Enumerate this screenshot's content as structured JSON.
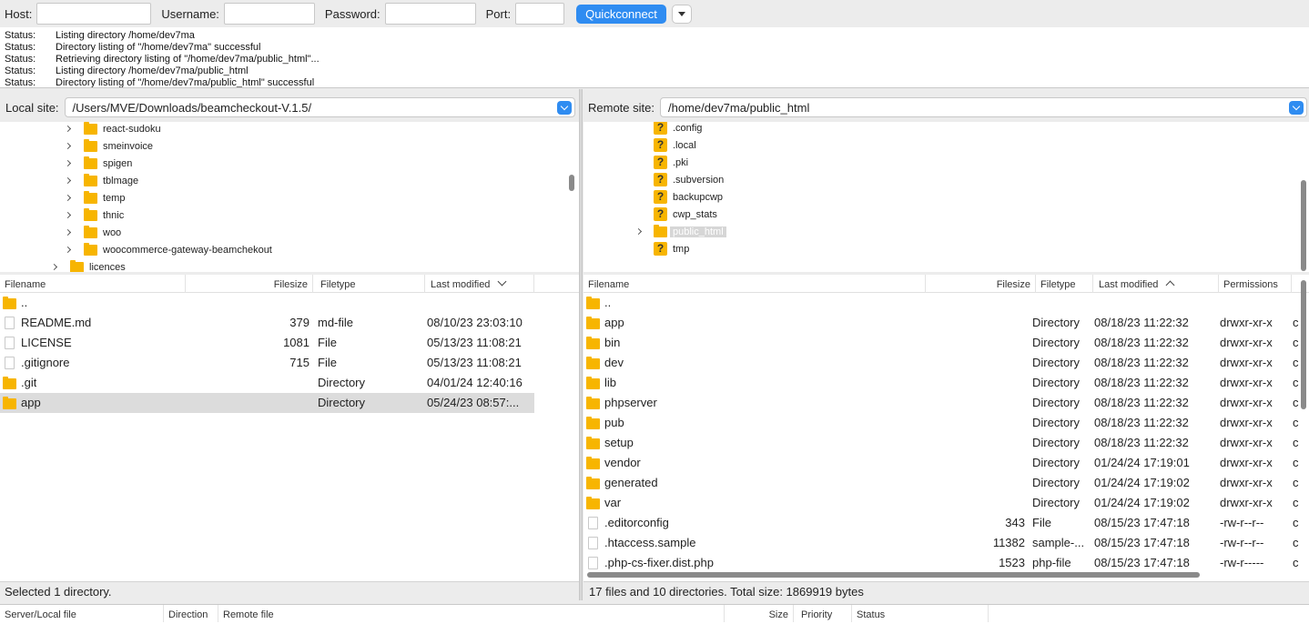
{
  "quickconnect": {
    "host_label": "Host:",
    "username_label": "Username:",
    "password_label": "Password:",
    "port_label": "Port:",
    "button_label": "Quickconnect"
  },
  "log": [
    {
      "label": "Status:",
      "text": "Listing directory /home/dev7ma"
    },
    {
      "label": "Status:",
      "text": "Directory listing of \"/home/dev7ma\" successful"
    },
    {
      "label": "Status:",
      "text": "Retrieving directory listing of \"/home/dev7ma/public_html\"..."
    },
    {
      "label": "Status:",
      "text": "Listing directory /home/dev7ma/public_html"
    },
    {
      "label": "Status:",
      "text": "Directory listing of \"/home/dev7ma/public_html\" successful"
    }
  ],
  "local": {
    "site_label": "Local site:",
    "path": "/Users/MVE/Downloads/beamcheckout-V.1.5/",
    "tree": [
      {
        "name": "react-sudoku"
      },
      {
        "name": "smeinvoice"
      },
      {
        "name": "spigen"
      },
      {
        "name": "tblmage"
      },
      {
        "name": "temp"
      },
      {
        "name": "thnic"
      },
      {
        "name": "woo"
      },
      {
        "name": "woocommerce-gateway-beamchekout"
      },
      {
        "name": "licences"
      }
    ],
    "columns": {
      "filename": "Filename",
      "filesize": "Filesize",
      "filetype": "Filetype",
      "modified": "Last modified"
    },
    "files": [
      {
        "name": "..",
        "size": "",
        "type": "",
        "modified": "",
        "kind": "folder"
      },
      {
        "name": "README.md",
        "size": "379",
        "type": "md-file",
        "modified": "08/10/23 23:03:10",
        "kind": "file"
      },
      {
        "name": "LICENSE",
        "size": "1081",
        "type": "File",
        "modified": "05/13/23 11:08:21",
        "kind": "file"
      },
      {
        "name": ".gitignore",
        "size": "715",
        "type": "File",
        "modified": "05/13/23 11:08:21",
        "kind": "file"
      },
      {
        "name": ".git",
        "size": "",
        "type": "Directory",
        "modified": "04/01/24 12:40:16",
        "kind": "folder"
      },
      {
        "name": "app",
        "size": "",
        "type": "Directory",
        "modified": "05/24/23 08:57:...",
        "kind": "folder",
        "selected": true
      }
    ],
    "status": "Selected 1 directory."
  },
  "remote": {
    "site_label": "Remote site:",
    "path": "/home/dev7ma/public_html",
    "tree": [
      {
        "name": ".config",
        "icon": "q"
      },
      {
        "name": ".local",
        "icon": "q"
      },
      {
        "name": ".pki",
        "icon": "q"
      },
      {
        "name": ".subversion",
        "icon": "q"
      },
      {
        "name": "backupcwp",
        "icon": "q"
      },
      {
        "name": "cwp_stats",
        "icon": "q"
      },
      {
        "name": "public_html",
        "icon": "folder"
      },
      {
        "name": "tmp",
        "icon": "q"
      }
    ],
    "columns": {
      "filename": "Filename",
      "filesize": "Filesize",
      "filetype": "Filetype",
      "modified": "Last modified",
      "permissions": "Permissions"
    },
    "files": [
      {
        "name": "..",
        "size": "",
        "type": "",
        "modified": "",
        "perms": "",
        "extra": "",
        "kind": "folder"
      },
      {
        "name": "app",
        "size": "",
        "type": "Directory",
        "modified": "08/18/23 11:22:32",
        "perms": "drwxr-xr-x",
        "extra": "c",
        "kind": "folder"
      },
      {
        "name": "bin",
        "size": "",
        "type": "Directory",
        "modified": "08/18/23 11:22:32",
        "perms": "drwxr-xr-x",
        "extra": "c",
        "kind": "folder"
      },
      {
        "name": "dev",
        "size": "",
        "type": "Directory",
        "modified": "08/18/23 11:22:32",
        "perms": "drwxr-xr-x",
        "extra": "c",
        "kind": "folder"
      },
      {
        "name": "lib",
        "size": "",
        "type": "Directory",
        "modified": "08/18/23 11:22:32",
        "perms": "drwxr-xr-x",
        "extra": "c",
        "kind": "folder"
      },
      {
        "name": "phpserver",
        "size": "",
        "type": "Directory",
        "modified": "08/18/23 11:22:32",
        "perms": "drwxr-xr-x",
        "extra": "c",
        "kind": "folder"
      },
      {
        "name": "pub",
        "size": "",
        "type": "Directory",
        "modified": "08/18/23 11:22:32",
        "perms": "drwxr-xr-x",
        "extra": "c",
        "kind": "folder"
      },
      {
        "name": "setup",
        "size": "",
        "type": "Directory",
        "modified": "08/18/23 11:22:32",
        "perms": "drwxr-xr-x",
        "extra": "c",
        "kind": "folder"
      },
      {
        "name": "vendor",
        "size": "",
        "type": "Directory",
        "modified": "01/24/24 17:19:01",
        "perms": "drwxr-xr-x",
        "extra": "c",
        "kind": "folder"
      },
      {
        "name": "generated",
        "size": "",
        "type": "Directory",
        "modified": "01/24/24 17:19:02",
        "perms": "drwxr-xr-x",
        "extra": "c",
        "kind": "folder"
      },
      {
        "name": "var",
        "size": "",
        "type": "Directory",
        "modified": "01/24/24 17:19:02",
        "perms": "drwxr-xr-x",
        "extra": "c",
        "kind": "folder"
      },
      {
        "name": ".editorconfig",
        "size": "343",
        "type": "File",
        "modified": "08/15/23 17:47:18",
        "perms": "-rw-r--r--",
        "extra": "c",
        "kind": "file"
      },
      {
        "name": ".htaccess.sample",
        "size": "11382",
        "type": "sample-...",
        "modified": "08/15/23 17:47:18",
        "perms": "-rw-r--r--",
        "extra": "c",
        "kind": "file"
      },
      {
        "name": ".php-cs-fixer.dist.php",
        "size": "1523",
        "type": "php-file",
        "modified": "08/15/23 17:47:18",
        "perms": "-rw-r-----",
        "extra": "c",
        "kind": "file"
      }
    ],
    "status": "17 files and 10 directories. Total size: 1869919 bytes"
  },
  "queue": {
    "columns": [
      "Server/Local file",
      "Direction",
      "Remote file",
      "Size",
      "Priority",
      "Status"
    ]
  },
  "colors": {
    "accent": "#2f8cf1",
    "folder": "#f7b500",
    "selection": "#dcdcdc"
  }
}
